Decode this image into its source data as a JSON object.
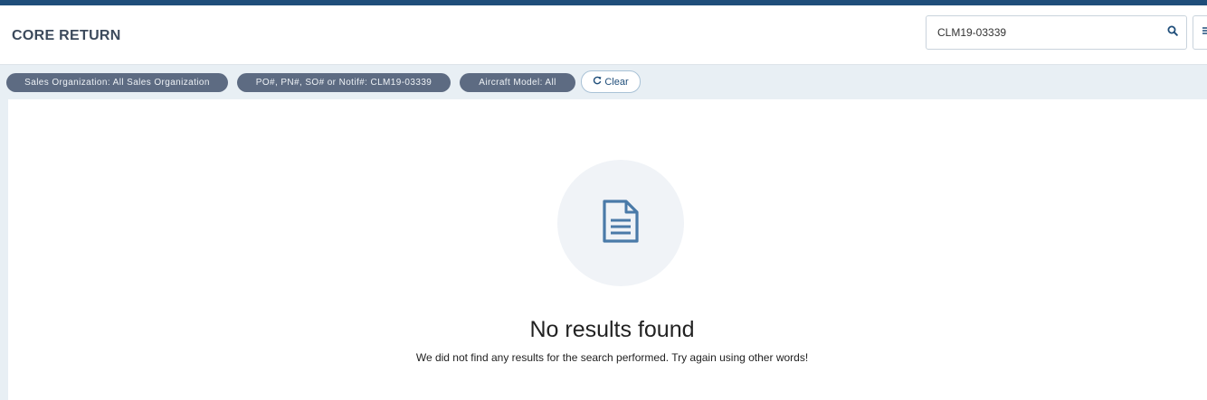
{
  "header": {
    "title": "CORE RETURN",
    "search": {
      "value": "CLM19-03339",
      "placeholder": ""
    },
    "search_button_icon": "search-icon",
    "filter_button_icon": "filter-sliders-icon"
  },
  "filters": {
    "chips": [
      {
        "label": "Sales Organization: All Sales Organization"
      },
      {
        "label": "PO#, PN#, SO# or Notif#: CLM19-03339"
      },
      {
        "label": "Aircraft Model: All"
      }
    ],
    "clear_label": "Clear",
    "clear_icon": "refresh-icon"
  },
  "empty_state": {
    "icon": "document-icon",
    "title": "No results found",
    "message": "We did not find any results for the search performed. Try again using other words!"
  },
  "colors": {
    "brand": "#1f4e7a",
    "chip": "#5d6b82",
    "filterbar": "#e8eff4",
    "icon": "#4a7aa8"
  }
}
